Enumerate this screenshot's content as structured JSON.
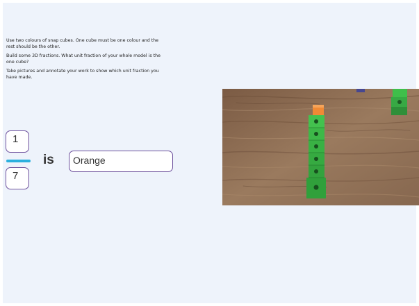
{
  "instructions": {
    "line1": "Use two colours of snap cubes. One cube must be one colour and the rest should be the other.",
    "line2": "Build some 3D fractions. What unit fraction of your whole model is the one cube?",
    "line3": "Take pictures and annotate your work to show which unit fraction you have made."
  },
  "fraction": {
    "numerator": "1",
    "denominator": "7",
    "connector": "is",
    "answer": "Orange"
  },
  "photo": {
    "subject": "snap cube tower: 1 orange cube on top of 6 green cubes on a wooden table",
    "colors": {
      "wood": "#8a6a50",
      "cube_green": "#3fbf4a",
      "cube_orange": "#f08a35"
    }
  },
  "colors": {
    "slide_bg": "#eef3fb",
    "box_border": "#6c4f9c",
    "fraction_bar": "#2bb0de"
  }
}
